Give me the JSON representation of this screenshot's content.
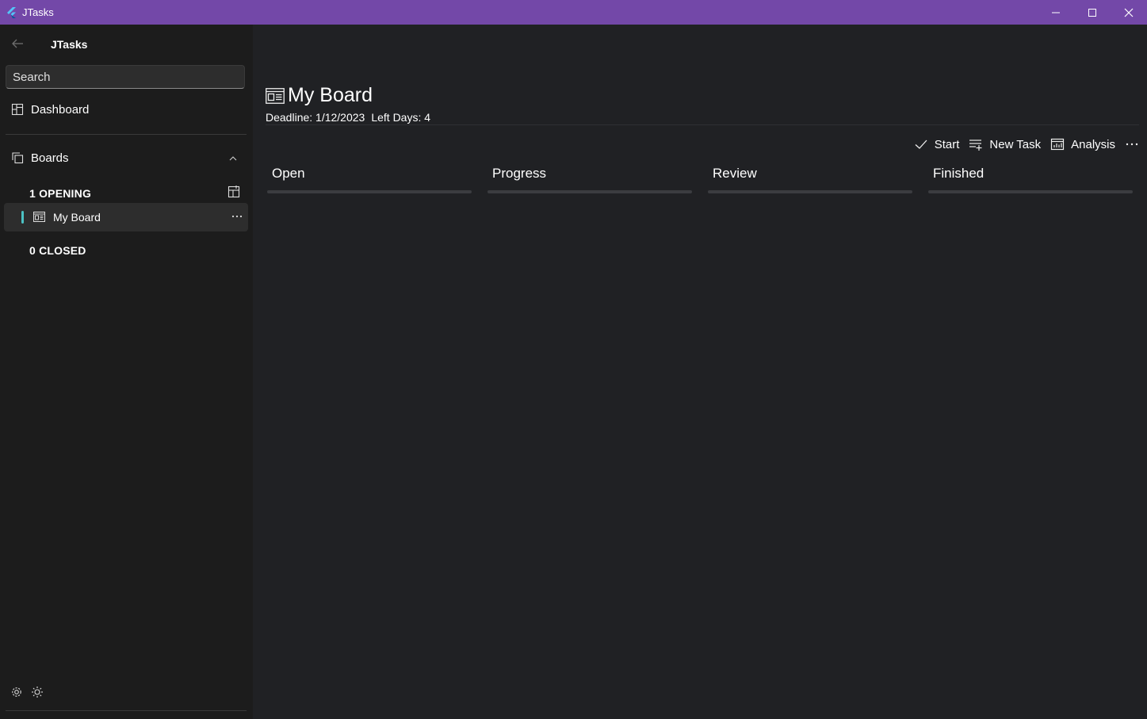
{
  "window": {
    "title": "JTasks"
  },
  "sidebar": {
    "app_name": "JTasks",
    "search_placeholder": "Search",
    "dashboard_label": "Dashboard",
    "boards_label": "Boards",
    "opening_label": "1 OPENING",
    "closed_label": "0 CLOSED",
    "boards": [
      {
        "label": "My Board"
      }
    ]
  },
  "main": {
    "board_title": "My Board",
    "deadline": "Deadline: 1/12/2023",
    "left_days": "Left Days: 4",
    "toolbar": {
      "start": "Start",
      "new_task": "New Task",
      "analysis": "Analysis"
    },
    "columns": [
      {
        "label": "Open"
      },
      {
        "label": "Progress"
      },
      {
        "label": "Review"
      },
      {
        "label": "Finished"
      }
    ]
  },
  "colors": {
    "titlebar": "#7348a8",
    "accent": "#4cc2c4",
    "background": "#202124",
    "sidebar": "#1c1c1c"
  }
}
